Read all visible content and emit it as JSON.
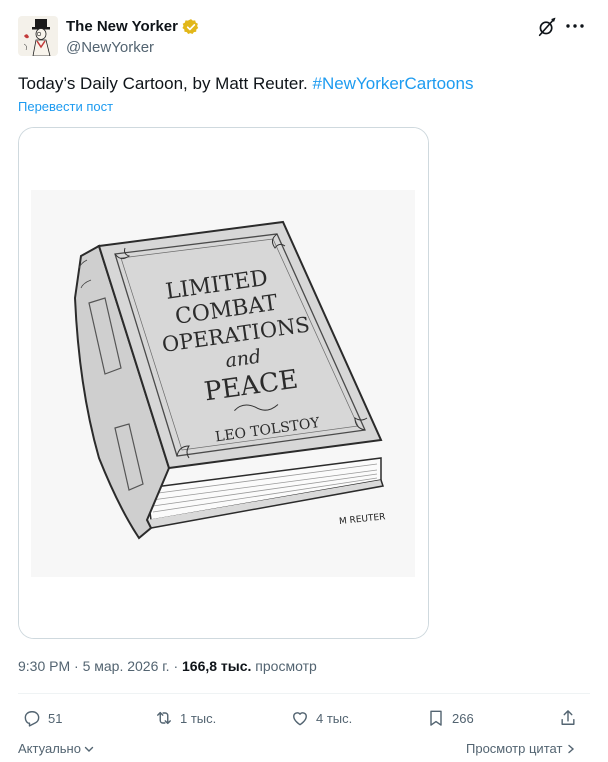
{
  "author": {
    "name": "The New Yorker",
    "handle": "@NewYorker"
  },
  "tweet": {
    "text": "Today’s Daily Cartoon, by Matt Reuter. ",
    "hashtag": "#NewYorkerCartoons",
    "translate_label": "Перевести пост"
  },
  "cartoon": {
    "title_line1": "LIMITED",
    "title_line2": "COMBAT",
    "title_line3": "OPERATIONS",
    "title_line4": "and",
    "title_line5": "PEACE",
    "book_author": "LEO TOLSTOY",
    "signature": "M REUTER"
  },
  "meta": {
    "time_date": "9:30 PM · 5 мар. 2026 г. · ",
    "views_count": "166,8 тыс.",
    "views_label": " просмотр"
  },
  "actions": {
    "replies": "51",
    "reposts": "1 тыс.",
    "likes": "4 тыс.",
    "bookmarks": "266"
  },
  "footer": {
    "sort_label": "Актуально",
    "quotes_label": "Просмотр цитат"
  },
  "colors": {
    "accent": "#1d9bf0",
    "secondary_text": "#536471",
    "verified_badge": "#e2b719"
  }
}
